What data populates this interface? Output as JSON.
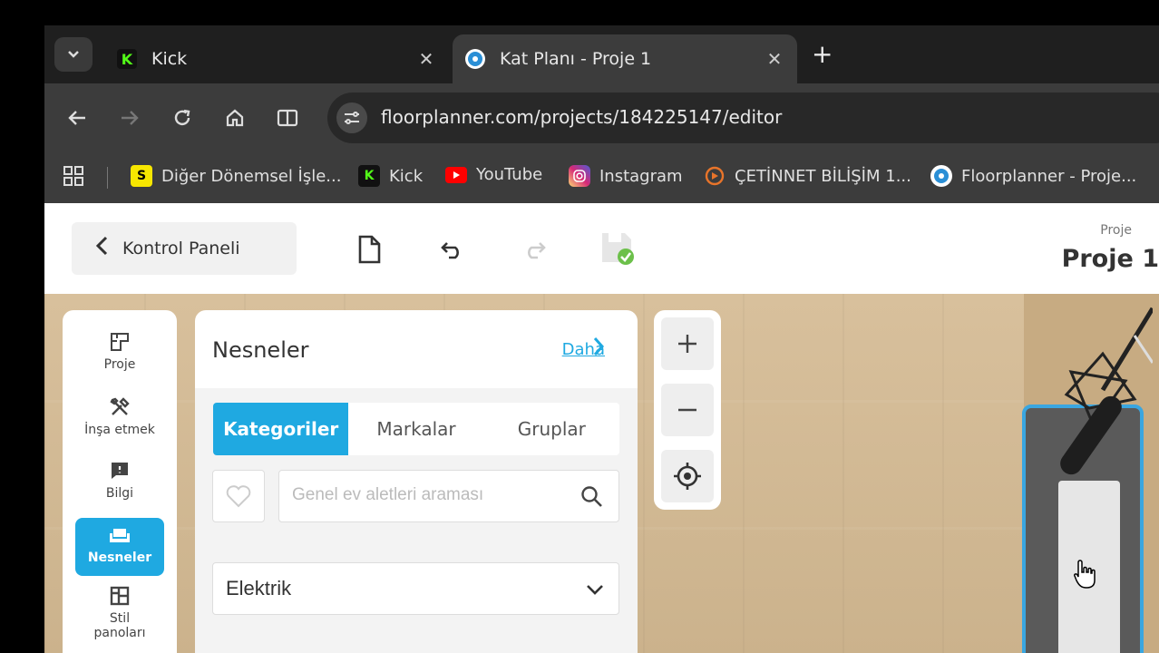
{
  "browser": {
    "tabs": [
      {
        "title": "Kick",
        "active": false,
        "favicon": "K",
        "favicon_color": "#53fc18"
      },
      {
        "title": "Kat Planı - Proje 1",
        "active": true,
        "favicon": "floorplanner-icon",
        "favicon_color": "#2a8fd6"
      }
    ],
    "url": "floorplanner.com/projects/184225147/editor",
    "bookmarks": [
      {
        "label": "Diğer Dönemsel İşle...",
        "icon": "S",
        "color": "#f7e600"
      },
      {
        "label": "Kick",
        "icon": "K",
        "color": "#53fc18"
      },
      {
        "label": "YouTube",
        "icon": "youtube-icon",
        "color": "#ff0000"
      },
      {
        "label": "Instagram",
        "icon": "instagram-icon",
        "color": "#d62976"
      },
      {
        "label": "ÇETİNNET BİLİŞİM 1...",
        "icon": "cetinnet-icon",
        "color": "#e8742a"
      },
      {
        "label": "Floorplanner - Proje...",
        "icon": "floorplanner-icon",
        "color": "#2a8fd6"
      }
    ]
  },
  "header": {
    "back_label": "Kontrol Paneli",
    "project_label": "Proje",
    "project_name": "Proje 1"
  },
  "sidebar": {
    "items": [
      {
        "label": "Proje",
        "icon": "floorplan-icon",
        "active": false
      },
      {
        "label": "İnşa etmek",
        "icon": "tools-icon",
        "active": false
      },
      {
        "label": "Bilgi",
        "icon": "info-icon",
        "active": false
      },
      {
        "label": "Nesneler",
        "icon": "sofa-icon",
        "active": true
      },
      {
        "label": "Stil panoları",
        "icon": "layout-icon",
        "active": false
      }
    ]
  },
  "panel": {
    "title": "Nesneler",
    "more_label": "Daha",
    "tabs": [
      "Kategoriler",
      "Markalar",
      "Gruplar"
    ],
    "active_tab": "Kategoriler",
    "search_placeholder": "Genel ev aletleri araması",
    "category_value": "Elektrik"
  },
  "colors": {
    "accent": "#1fa9e1",
    "floor": "#d2b994"
  }
}
